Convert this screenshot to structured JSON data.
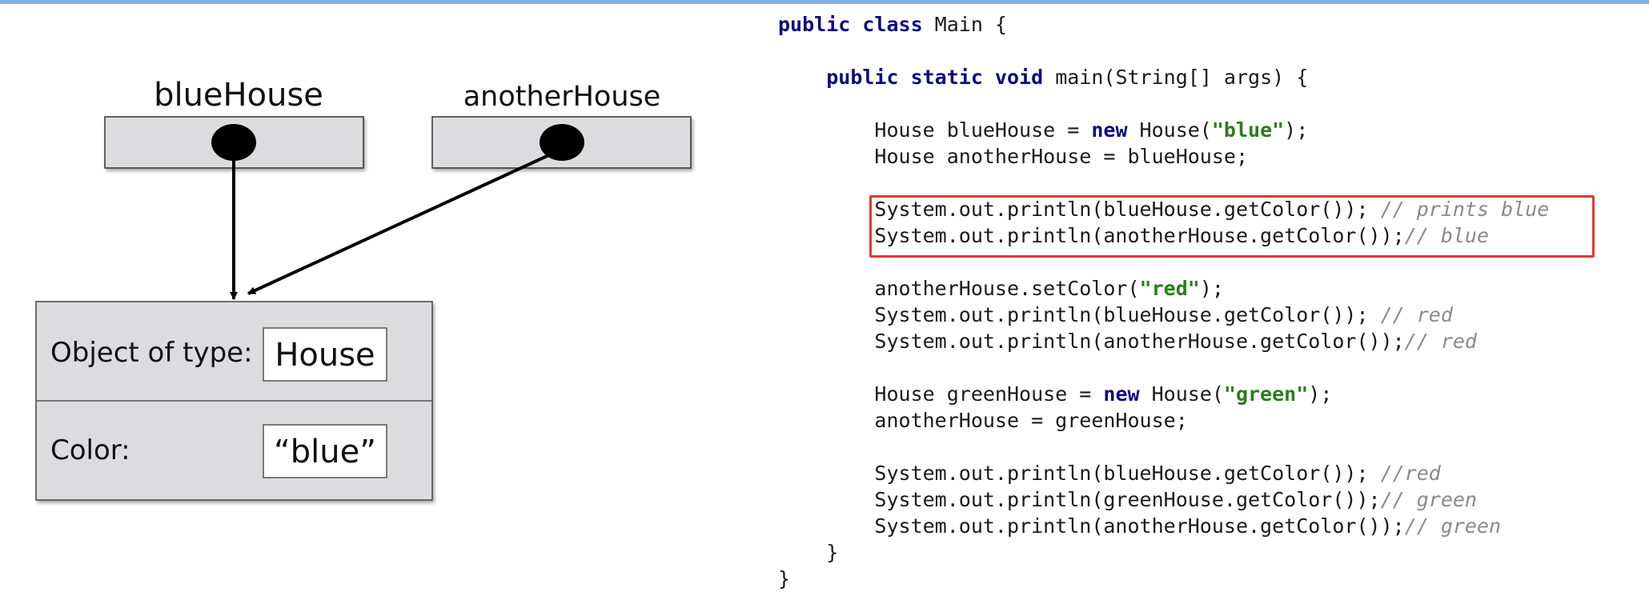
{
  "diagram": {
    "variables": [
      {
        "label": "blueHouse"
      },
      {
        "label": "anotherHouse"
      }
    ],
    "object": {
      "type_label": "Object of type:",
      "type_value": "House",
      "color_label": "Color:",
      "color_value": "“blue”"
    }
  },
  "code": {
    "lines": [
      [
        [
          "kw",
          "public class"
        ],
        [
          "t",
          " Main {"
        ]
      ],
      [],
      [
        [
          "t",
          "    "
        ],
        [
          "kw",
          "public static void"
        ],
        [
          "t",
          " main(String[] args) {"
        ]
      ],
      [],
      [
        [
          "t",
          "        House blueHouse = "
        ],
        [
          "kw",
          "new"
        ],
        [
          "t",
          " House("
        ],
        [
          "str",
          "\"blue\""
        ],
        [
          "t",
          ");"
        ]
      ],
      [
        [
          "t",
          "        House anotherHouse = blueHouse;"
        ]
      ],
      [],
      [
        [
          "t",
          "        System.out.println(blueHouse.getColor()); "
        ],
        [
          "cm",
          "// prints blue"
        ]
      ],
      [
        [
          "t",
          "        System.out.println(anotherHouse.getColor());"
        ],
        [
          "cm",
          "// blue"
        ]
      ],
      [],
      [
        [
          "t",
          "        anotherHouse.setColor("
        ],
        [
          "str",
          "\"red\""
        ],
        [
          "t",
          ");"
        ]
      ],
      [
        [
          "t",
          "        System.out.println(blueHouse.getColor()); "
        ],
        [
          "cm",
          "// red"
        ]
      ],
      [
        [
          "t",
          "        System.out.println(anotherHouse.getColor());"
        ],
        [
          "cm",
          "// red"
        ]
      ],
      [],
      [
        [
          "t",
          "        House greenHouse = "
        ],
        [
          "kw",
          "new"
        ],
        [
          "t",
          " House("
        ],
        [
          "str",
          "\"green\""
        ],
        [
          "t",
          ");"
        ]
      ],
      [
        [
          "t",
          "        anotherHouse = greenHouse;"
        ]
      ],
      [],
      [
        [
          "t",
          "        System.out.println(blueHouse.getColor()); "
        ],
        [
          "cm",
          "//red"
        ]
      ],
      [
        [
          "t",
          "        System.out.println(greenHouse.getColor());"
        ],
        [
          "cm",
          "// green"
        ]
      ],
      [
        [
          "t",
          "        System.out.println(anotherHouse.getColor());"
        ],
        [
          "cm",
          "// green"
        ]
      ],
      [
        [
          "t",
          "    }"
        ]
      ],
      [
        [
          "t",
          "}"
        ]
      ]
    ]
  },
  "colors": {
    "box_fill": "#dcdcde",
    "highlight": "#e53535",
    "keyword": "#0b0b7f",
    "string": "#2b7d1d",
    "comment": "#8a8a8a"
  }
}
